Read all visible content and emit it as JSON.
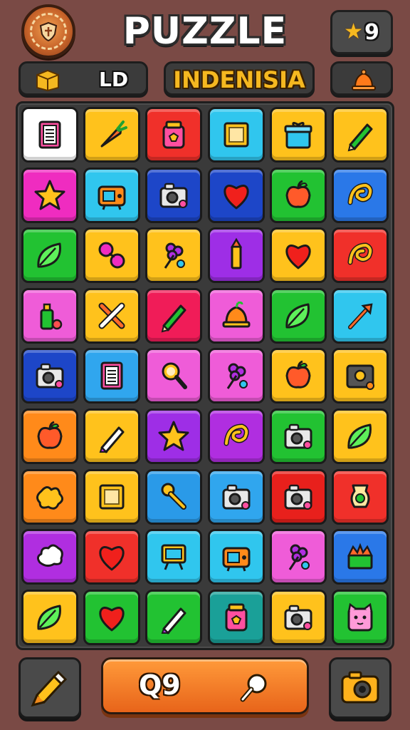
{
  "header": {
    "title": "PUZZLE",
    "stars": "9",
    "left_label": "LD",
    "region_label": "INDENISIA",
    "badge_icon": "emblem-badge-icon",
    "star_icon": "star-icon",
    "box_icon": "box-icon",
    "bell_icon": "bell-icon"
  },
  "board": {
    "rows": 9,
    "cols": 6,
    "tiles": [
      {
        "color": "#ffffff",
        "icon": "notepad"
      },
      {
        "color": "#ffc21c",
        "icon": "carrot"
      },
      {
        "color": "#f0302a",
        "icon": "jar"
      },
      {
        "color": "#30c6ee",
        "icon": "frame"
      },
      {
        "color": "#ffc21c",
        "icon": "gift"
      },
      {
        "color": "#ffc21c",
        "icon": "pencil"
      },
      {
        "color": "#ef2cc0",
        "icon": "star"
      },
      {
        "color": "#30c6ee",
        "icon": "radio"
      },
      {
        "color": "#1d46c8",
        "icon": "camera"
      },
      {
        "color": "#1d46c8",
        "icon": "heart"
      },
      {
        "color": "#22c232",
        "icon": "apple"
      },
      {
        "color": "#2a78e8",
        "icon": "swirl"
      },
      {
        "color": "#22c232",
        "icon": "leaf"
      },
      {
        "color": "#ffc21c",
        "icon": "cherries"
      },
      {
        "color": "#ffc21c",
        "icon": "flower"
      },
      {
        "color": "#9e2ee6",
        "icon": "crayon"
      },
      {
        "color": "#ffc21c",
        "icon": "heart"
      },
      {
        "color": "#f0302a",
        "icon": "swirl"
      },
      {
        "color": "#ef5cd8",
        "icon": "bottle"
      },
      {
        "color": "#ffc21c",
        "icon": "cross"
      },
      {
        "color": "#f01c58",
        "icon": "pencil"
      },
      {
        "color": "#ef5cd8",
        "icon": "bell"
      },
      {
        "color": "#22c232",
        "icon": "leaf"
      },
      {
        "color": "#30c6ee",
        "icon": "arrow"
      },
      {
        "color": "#1d46c8",
        "icon": "camera"
      },
      {
        "color": "#30a6ee",
        "icon": "notepad"
      },
      {
        "color": "#ef5cd8",
        "icon": "magnifier"
      },
      {
        "color": "#ef5cd8",
        "icon": "flower"
      },
      {
        "color": "#ffc21c",
        "icon": "apple"
      },
      {
        "color": "#ffc21c",
        "icon": "speaker"
      },
      {
        "color": "#ff8a1a",
        "icon": "apple"
      },
      {
        "color": "#ffc21c",
        "icon": "pen"
      },
      {
        "color": "#9e2ee6",
        "icon": "star"
      },
      {
        "color": "#b02ee0",
        "icon": "swirl"
      },
      {
        "color": "#22c232",
        "icon": "camera"
      },
      {
        "color": "#ffc21c",
        "icon": "leaf"
      },
      {
        "color": "#ff8a1a",
        "icon": "splat"
      },
      {
        "color": "#ffc21c",
        "icon": "frame"
      },
      {
        "color": "#2a9ae8",
        "icon": "key"
      },
      {
        "color": "#30a6ee",
        "icon": "camera"
      },
      {
        "color": "#e8201c",
        "icon": "camera"
      },
      {
        "color": "#f0302a",
        "icon": "vase"
      },
      {
        "color": "#b02ee0",
        "icon": "cloud"
      },
      {
        "color": "#f0302a",
        "icon": "heart"
      },
      {
        "color": "#30c6ee",
        "icon": "easel"
      },
      {
        "color": "#30c6ee",
        "icon": "radio"
      },
      {
        "color": "#ef5cd8",
        "icon": "flower"
      },
      {
        "color": "#2a78e8",
        "icon": "crown"
      },
      {
        "color": "#ffc21c",
        "icon": "leaf"
      },
      {
        "color": "#22c232",
        "icon": "heart"
      },
      {
        "color": "#22c232",
        "icon": "pen"
      },
      {
        "color": "#1aa098",
        "icon": "jar"
      },
      {
        "color": "#ffc21c",
        "icon": "camera"
      },
      {
        "color": "#22c232",
        "icon": "cat"
      }
    ]
  },
  "footer": {
    "count": "Q9",
    "left_icon": "marker-icon",
    "search_icon": "search-icon",
    "right_icon": "camera-icon"
  }
}
